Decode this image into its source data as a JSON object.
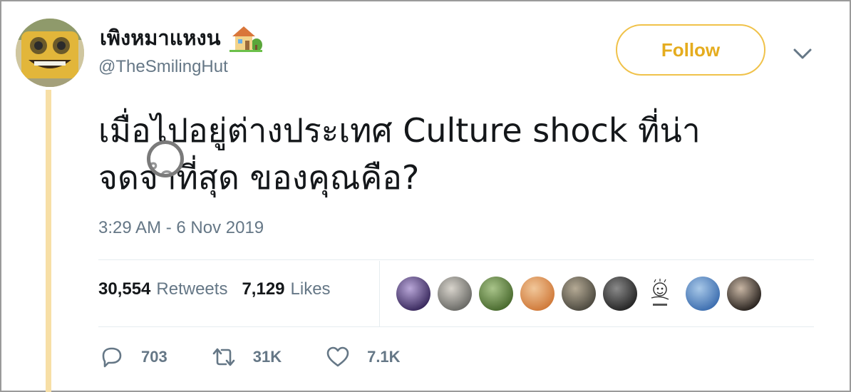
{
  "author": {
    "display_name": "เพิงหมาแหงน",
    "handle": "@TheSmilingHut"
  },
  "follow_label": "Follow",
  "tweet": {
    "text_line1": "เมื่อไปอยู่ต่างประเทศ Culture shock ที่น่า",
    "text_line2": "จดจำที่สุด ของคุณคือ?",
    "timestamp": "3:29 AM - 6 Nov 2019"
  },
  "stats": {
    "retweets_count": "30,554",
    "retweets_label": "Retweets",
    "likes_count": "7,129",
    "likes_label": "Likes"
  },
  "actions": {
    "reply_count": "703",
    "retweet_count": "31K",
    "like_count": "7.1K"
  },
  "icons": {
    "avatar": "smiling-hut-avatar",
    "emoji": "house-with-garden-icon",
    "menu": "chevron-down-icon",
    "reply": "reply-icon",
    "retweet": "retweet-icon",
    "like": "heart-icon"
  },
  "colors": {
    "accent": "#e5ac1e",
    "follow_border": "#f0c24a",
    "thread_line": "#f7dfa6",
    "secondary_text": "#657786"
  },
  "liker_avatar_colors": [
    [
      "#3a2a5e",
      "#b9a7d8"
    ],
    [
      "#6a6a66",
      "#d8d4cc"
    ],
    [
      "#4a6b2f",
      "#a9c48a"
    ],
    [
      "#d07a3a",
      "#f1c79a"
    ],
    [
      "#4d4a40",
      "#b5aa95"
    ],
    [
      "#262626",
      "#8a8a8a"
    ],
    [
      "#ffffff",
      "#ffffff"
    ],
    [
      "#3e6fb0",
      "#a8c8e8"
    ],
    [
      "#2a2420",
      "#c8b6a4"
    ]
  ]
}
